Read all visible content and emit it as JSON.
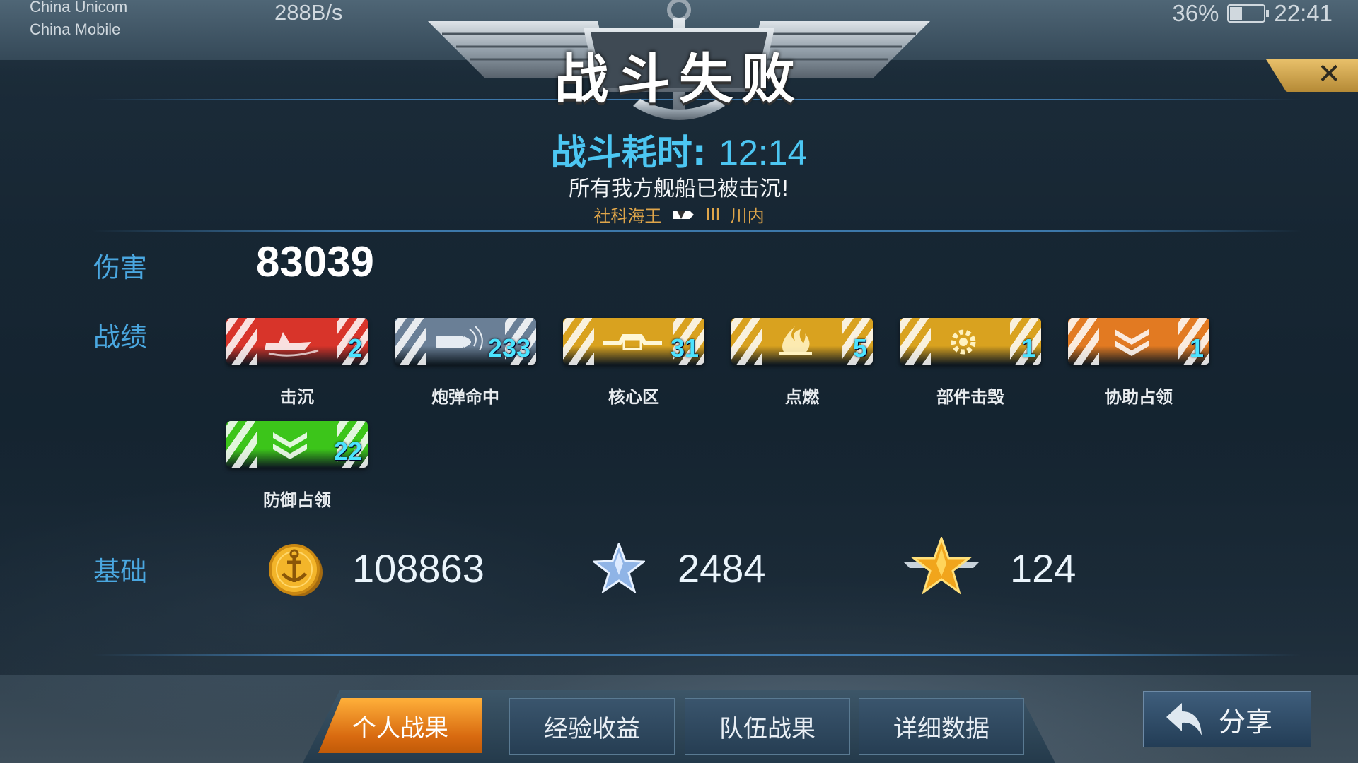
{
  "status_bar": {
    "carrier_1": "China Unicom",
    "carrier_2": "China Mobile",
    "net_speed": "288B/s",
    "battery_pct": "36%",
    "battery_level": 0.36,
    "time": "22:41"
  },
  "result": {
    "title": "战斗失败",
    "duration_label": "战斗耗时:",
    "duration_value": "12:14",
    "reason": "所有我方舰船已被击沉!",
    "player_name": "社科海王",
    "ship_tier": "III",
    "ship_name": "川内"
  },
  "labels": {
    "damage": "伤害",
    "record": "战绩",
    "base": "基础"
  },
  "damage_value": "83039",
  "achievements": [
    {
      "label": "击沉",
      "count": "2",
      "color": "#d8342a",
      "icon": "ship-icon"
    },
    {
      "label": "炮弹命中",
      "count": "233",
      "color": "#6a7f96",
      "icon": "shell-icon"
    },
    {
      "label": "核心区",
      "count": "31",
      "color": "#d9a21f",
      "icon": "core-icon"
    },
    {
      "label": "点燃",
      "count": "5",
      "color": "#d9a21f",
      "icon": "fire-icon"
    },
    {
      "label": "部件击毁",
      "count": "1",
      "color": "#d9a21f",
      "icon": "gear-icon"
    },
    {
      "label": "协助占领",
      "count": "1",
      "color": "#e27a22",
      "icon": "chevron-icon"
    },
    {
      "label": "防御占领",
      "count": "22",
      "color": "#3cc51a",
      "icon": "chevron-icon"
    }
  ],
  "base": {
    "coins": "108863",
    "experience": "2484",
    "captain_exp": "124"
  },
  "tabs": {
    "personal": "个人战果",
    "exp": "经验收益",
    "team": "队伍战果",
    "detail": "详细数据"
  },
  "share_label": "分享"
}
